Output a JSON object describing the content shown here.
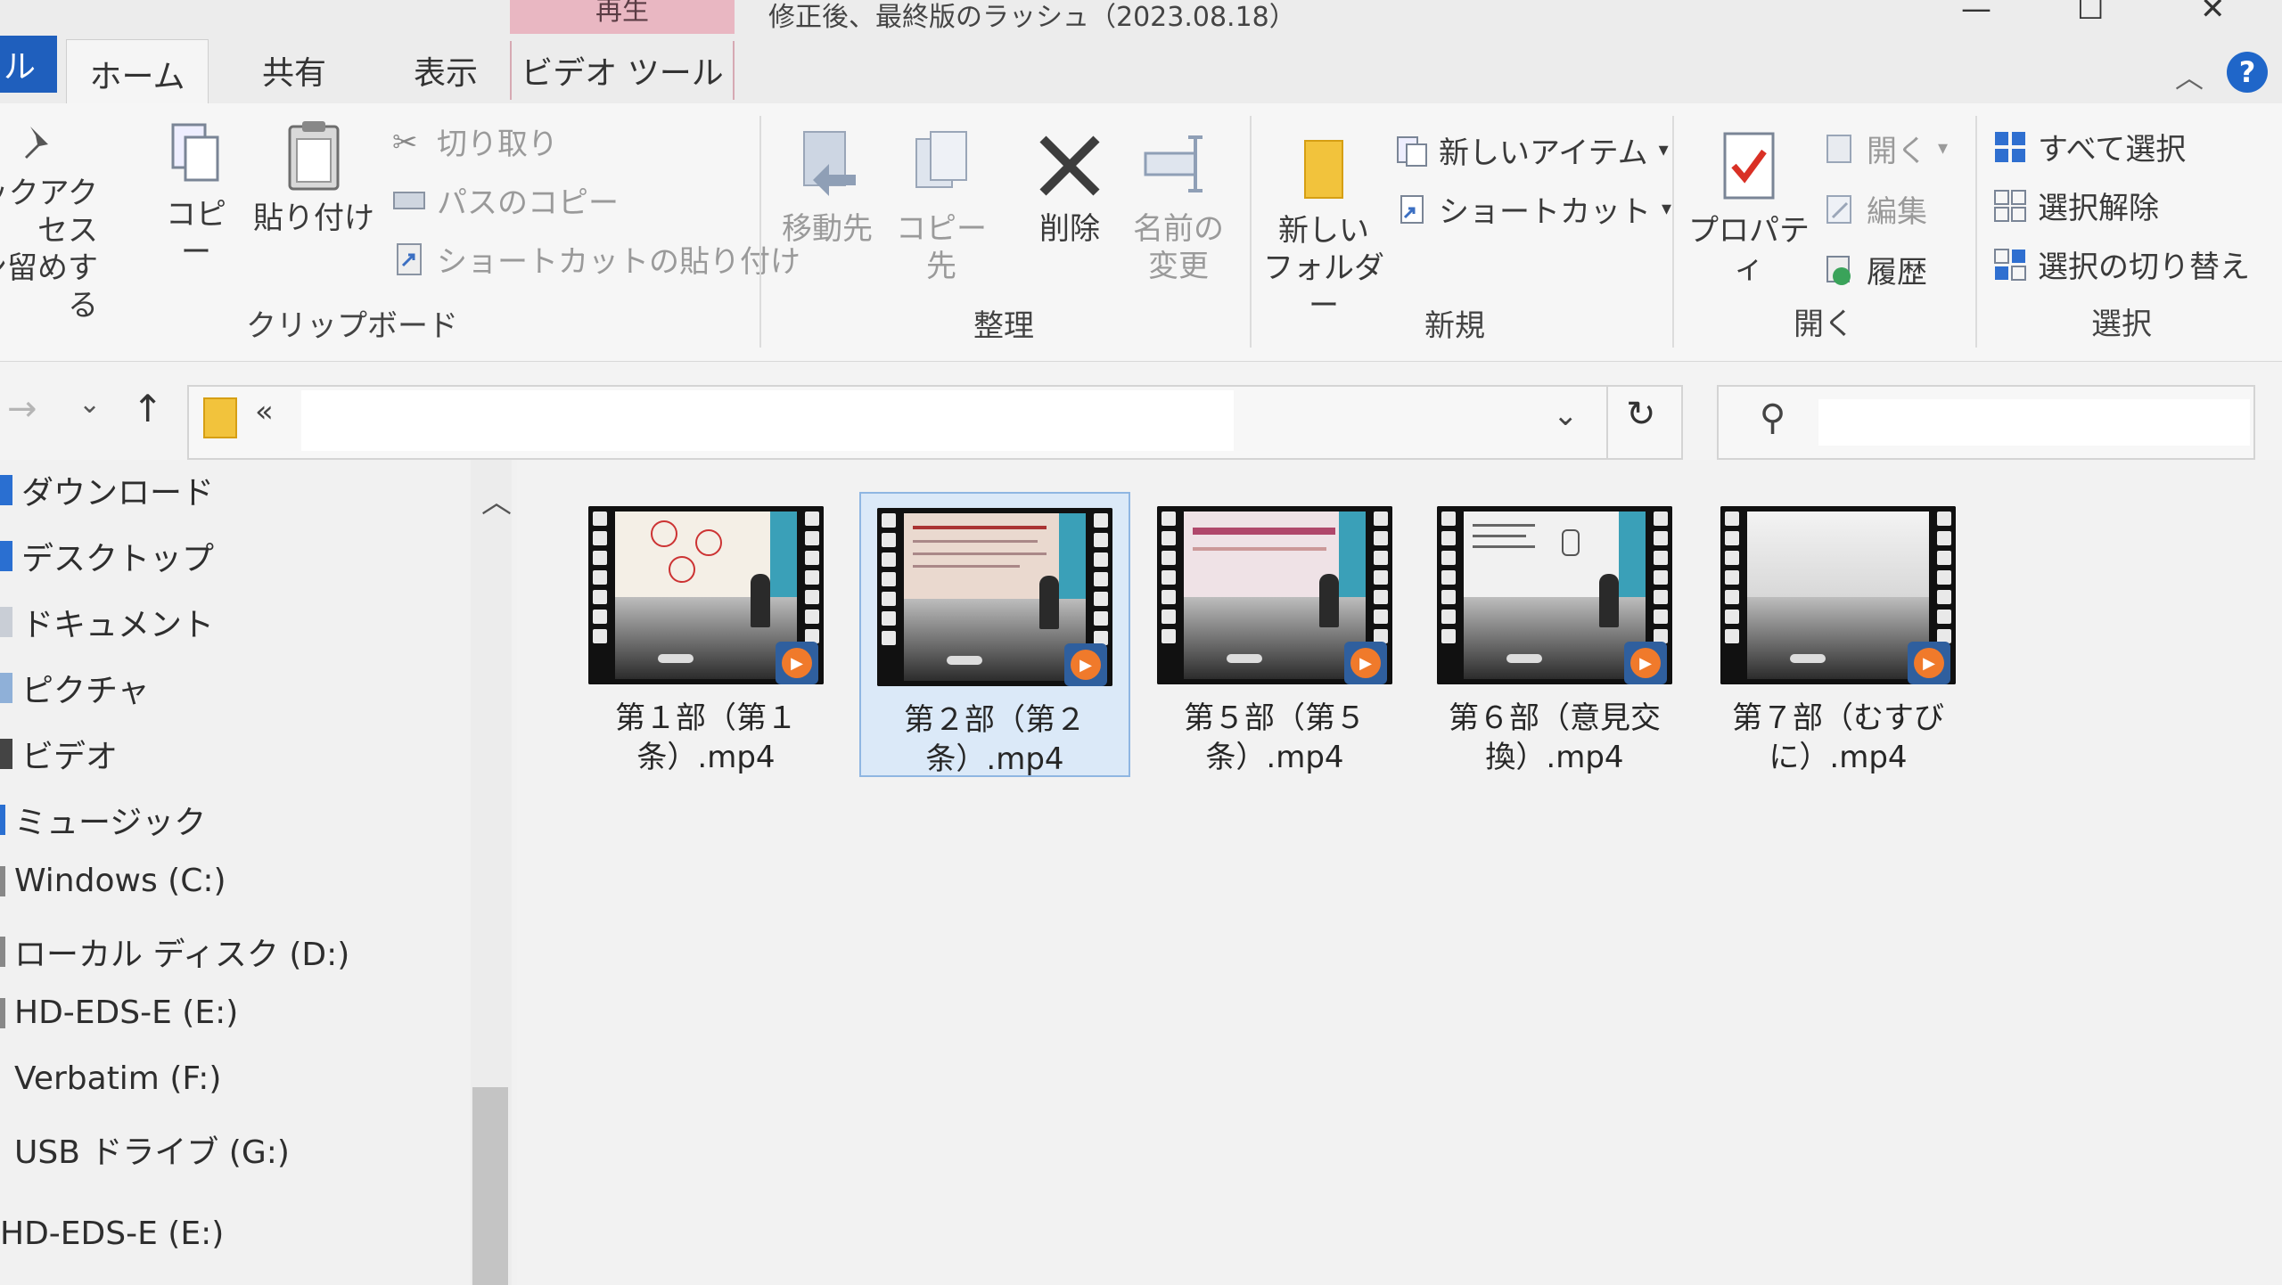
{
  "titlebar": {
    "context_tab": "再生",
    "title": "修正後、最終版のラッシュ（2023.08.18）",
    "min": "—",
    "max": "☐",
    "close": "✕"
  },
  "tabs": {
    "file": "ル",
    "home": "ホーム",
    "share": "共有",
    "view": "表示",
    "video_tools": "ビデオ ツール"
  },
  "ribbon": {
    "clipboard": {
      "pin_line1": "クイックアクセス",
      "pin_line2": "にピン留めする",
      "copy": "コピー",
      "paste": "貼り付け",
      "cut": "切り取り",
      "copy_path": "パスのコピー",
      "paste_shortcut": "ショートカットの貼り付け",
      "label": "クリップボード"
    },
    "organize": {
      "move_to": "移動先",
      "copy_to": "コピー先",
      "delete": "削除",
      "rename_line1": "名前の",
      "rename_line2": "変更",
      "label": "整理"
    },
    "new": {
      "new_folder_line1": "新しい",
      "new_folder_line2": "フォルダー",
      "new_item": "新しいアイテム",
      "shortcut": "ショートカット",
      "label": "新規"
    },
    "open": {
      "properties": "プロパティ",
      "open": "開く",
      "edit": "編集",
      "history": "履歴",
      "label": "開く"
    },
    "select": {
      "select_all": "すべて選択",
      "select_none": "選択解除",
      "invert": "選択の切り替え",
      "label": "選択"
    }
  },
  "navbar": {
    "breadcrumb_more": "«"
  },
  "navpane": {
    "items": [
      "ダウンロード",
      "デスクトップ",
      "ドキュメント",
      "ピクチャ",
      "ビデオ",
      "ミュージック",
      "Windows (C:)",
      "ローカル ディスク (D:)",
      "HD-EDS-E (E:)",
      "Verbatim (F:)",
      "USB ドライブ (G:)",
      "HD-EDS-E (E:)"
    ]
  },
  "files": [
    {
      "line1": "第１部（第１",
      "line2": "条）.mp4"
    },
    {
      "line1": "第２部（第２",
      "line2": "条）.mp4"
    },
    {
      "line1": "第５部（第５",
      "line2": "条）.mp4"
    },
    {
      "line1": "第６部（意見交",
      "line2": "換）.mp4"
    },
    {
      "line1": "第７部（むすび",
      "line2": "に）.mp4"
    }
  ],
  "colors": {
    "accent": "#1f5fbd",
    "context_tab": "#e9b7c2",
    "selection": "#dbe9f8",
    "play_badge": "#f07a2b"
  }
}
